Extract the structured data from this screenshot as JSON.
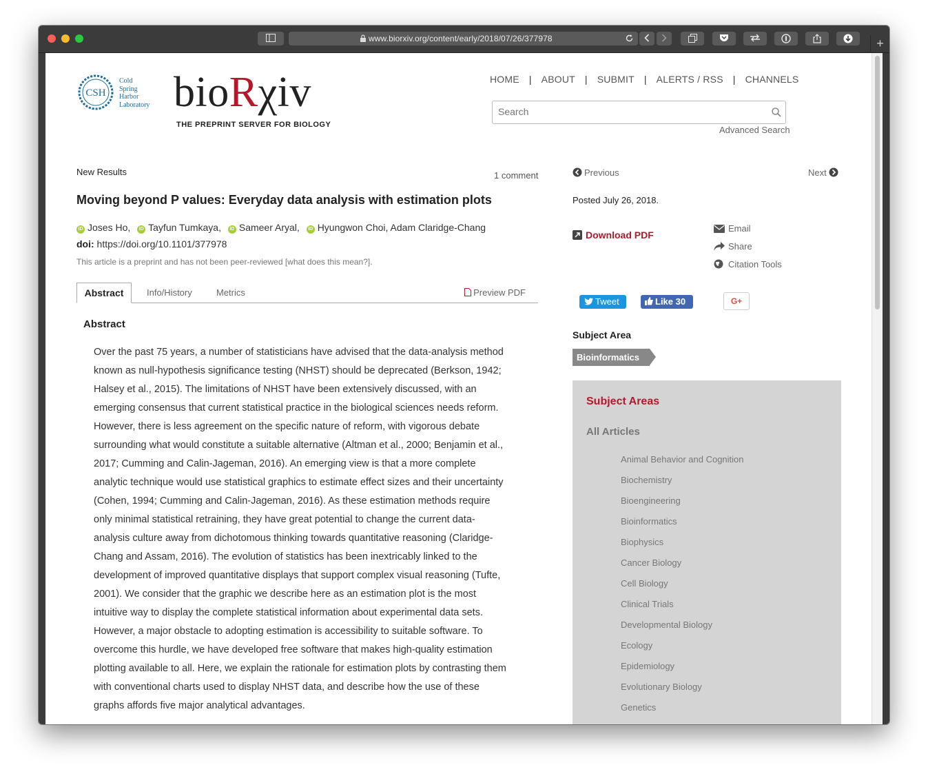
{
  "browser": {
    "url": "www.biorxiv.org/content/early/2018/07/26/377978"
  },
  "site": {
    "csh_lines": [
      "Cold",
      "Spring",
      "Harbor",
      "Laboratory"
    ],
    "csh_abbrev": "CSH",
    "brand_pre": "bio",
    "brand_red": "R",
    "brand_post": "χiv",
    "tagline": "THE PREPRINT SERVER FOR BIOLOGY"
  },
  "nav": {
    "items": [
      "HOME",
      "ABOUT",
      "SUBMIT",
      "ALERTS / RSS",
      "CHANNELS"
    ],
    "separator": "|"
  },
  "search": {
    "placeholder": "Search",
    "advanced": "Advanced Search"
  },
  "article": {
    "category": "New Results",
    "comments": "1 comment",
    "title": "Moving beyond P values: Everyday data analysis with estimation plots",
    "authors": [
      "Joses Ho,",
      "Tayfun Tumkaya,",
      "Sameer Aryal,",
      "Hyungwon Choi, Adam Claridge-Chang"
    ],
    "doi_label": "doi:",
    "doi": "https://doi.org/10.1101/377978",
    "preprint_note": "This article is a preprint and has not been peer-reviewed [what does this mean?]."
  },
  "tabs": {
    "items": [
      "Abstract",
      "Info/History",
      "Metrics"
    ],
    "active": "Abstract",
    "preview": "Preview PDF"
  },
  "abstract": {
    "heading": "Abstract",
    "lines": [
      "Over the past 75 years, a number of statisticians have advised that the data-analysis method",
      "known as null-hypothesis significance testing (NHST) should be deprecated (Berkson, 1942;",
      "Halsey et al., 2015). The limitations of NHST have been extensively discussed, with an",
      "emerging consensus that current statistical practice in the biological sciences needs reform.",
      "However, there is less agreement on the specific nature of reform, with vigorous debate",
      "surrounding what would constitute a suitable alternative (Altman et al., 2000; Benjamin et al.,",
      "2017; Cumming and Calin-Jageman, 2016). An emerging view is that a more complete",
      "analytic technique would use statistical graphics to estimate effect sizes and their uncertainty",
      "(Cohen, 1994; Cumming and Calin-Jageman, 2016). As these estimation methods require",
      "only minimal statistical retraining, they have great potential to change the current data-",
      "analysis culture away from dichotomous thinking towards quantitative reasoning (Claridge-",
      "Chang and Assam, 2016). The evolution of statistics has been inextricably linked to the",
      "development of improved quantitative displays that support complex visual reasoning (Tufte,",
      "2001). We consider that the graphic we describe here as an estimation plot is the most",
      "intuitive way to display the complete statistical information about experimental data sets.",
      "However, a major obstacle to adopting estimation is accessibility to suitable software. To",
      "overcome this hurdle, we have developed free software that makes high-quality estimation",
      "plotting available to all. Here, we explain the rationale for estimation plots by contrasting them",
      "with conventional charts used to display NHST data, and describe how the use of these",
      "graphs affords five major analytical advantages."
    ]
  },
  "sidebar": {
    "previous": "Previous",
    "next": "Next",
    "posted": "Posted July 26, 2018.",
    "download": "Download PDF",
    "email": "Email",
    "share": "Share",
    "citation": "Citation Tools",
    "tweet": "Tweet",
    "like": "Like 30",
    "gplus": "G+",
    "subject_label": "Subject Area",
    "subject_tag": "Bioinformatics",
    "panel_title": "Subject Areas",
    "panel_all": "All Articles",
    "subjects": [
      "Animal Behavior and Cognition",
      "Biochemistry",
      "Bioengineering",
      "Bioinformatics",
      "Biophysics",
      "Cancer Biology",
      "Cell Biology",
      "Clinical Trials",
      "Developmental Biology",
      "Ecology",
      "Epidemiology",
      "Evolutionary Biology",
      "Genetics"
    ]
  },
  "colors": {
    "brand_red": "#b5182b",
    "orcid_green": "#a6ce39",
    "twitter_blue": "#1b95e0",
    "facebook_blue": "#4267b2",
    "csh_blue": "#1b6e9e"
  }
}
